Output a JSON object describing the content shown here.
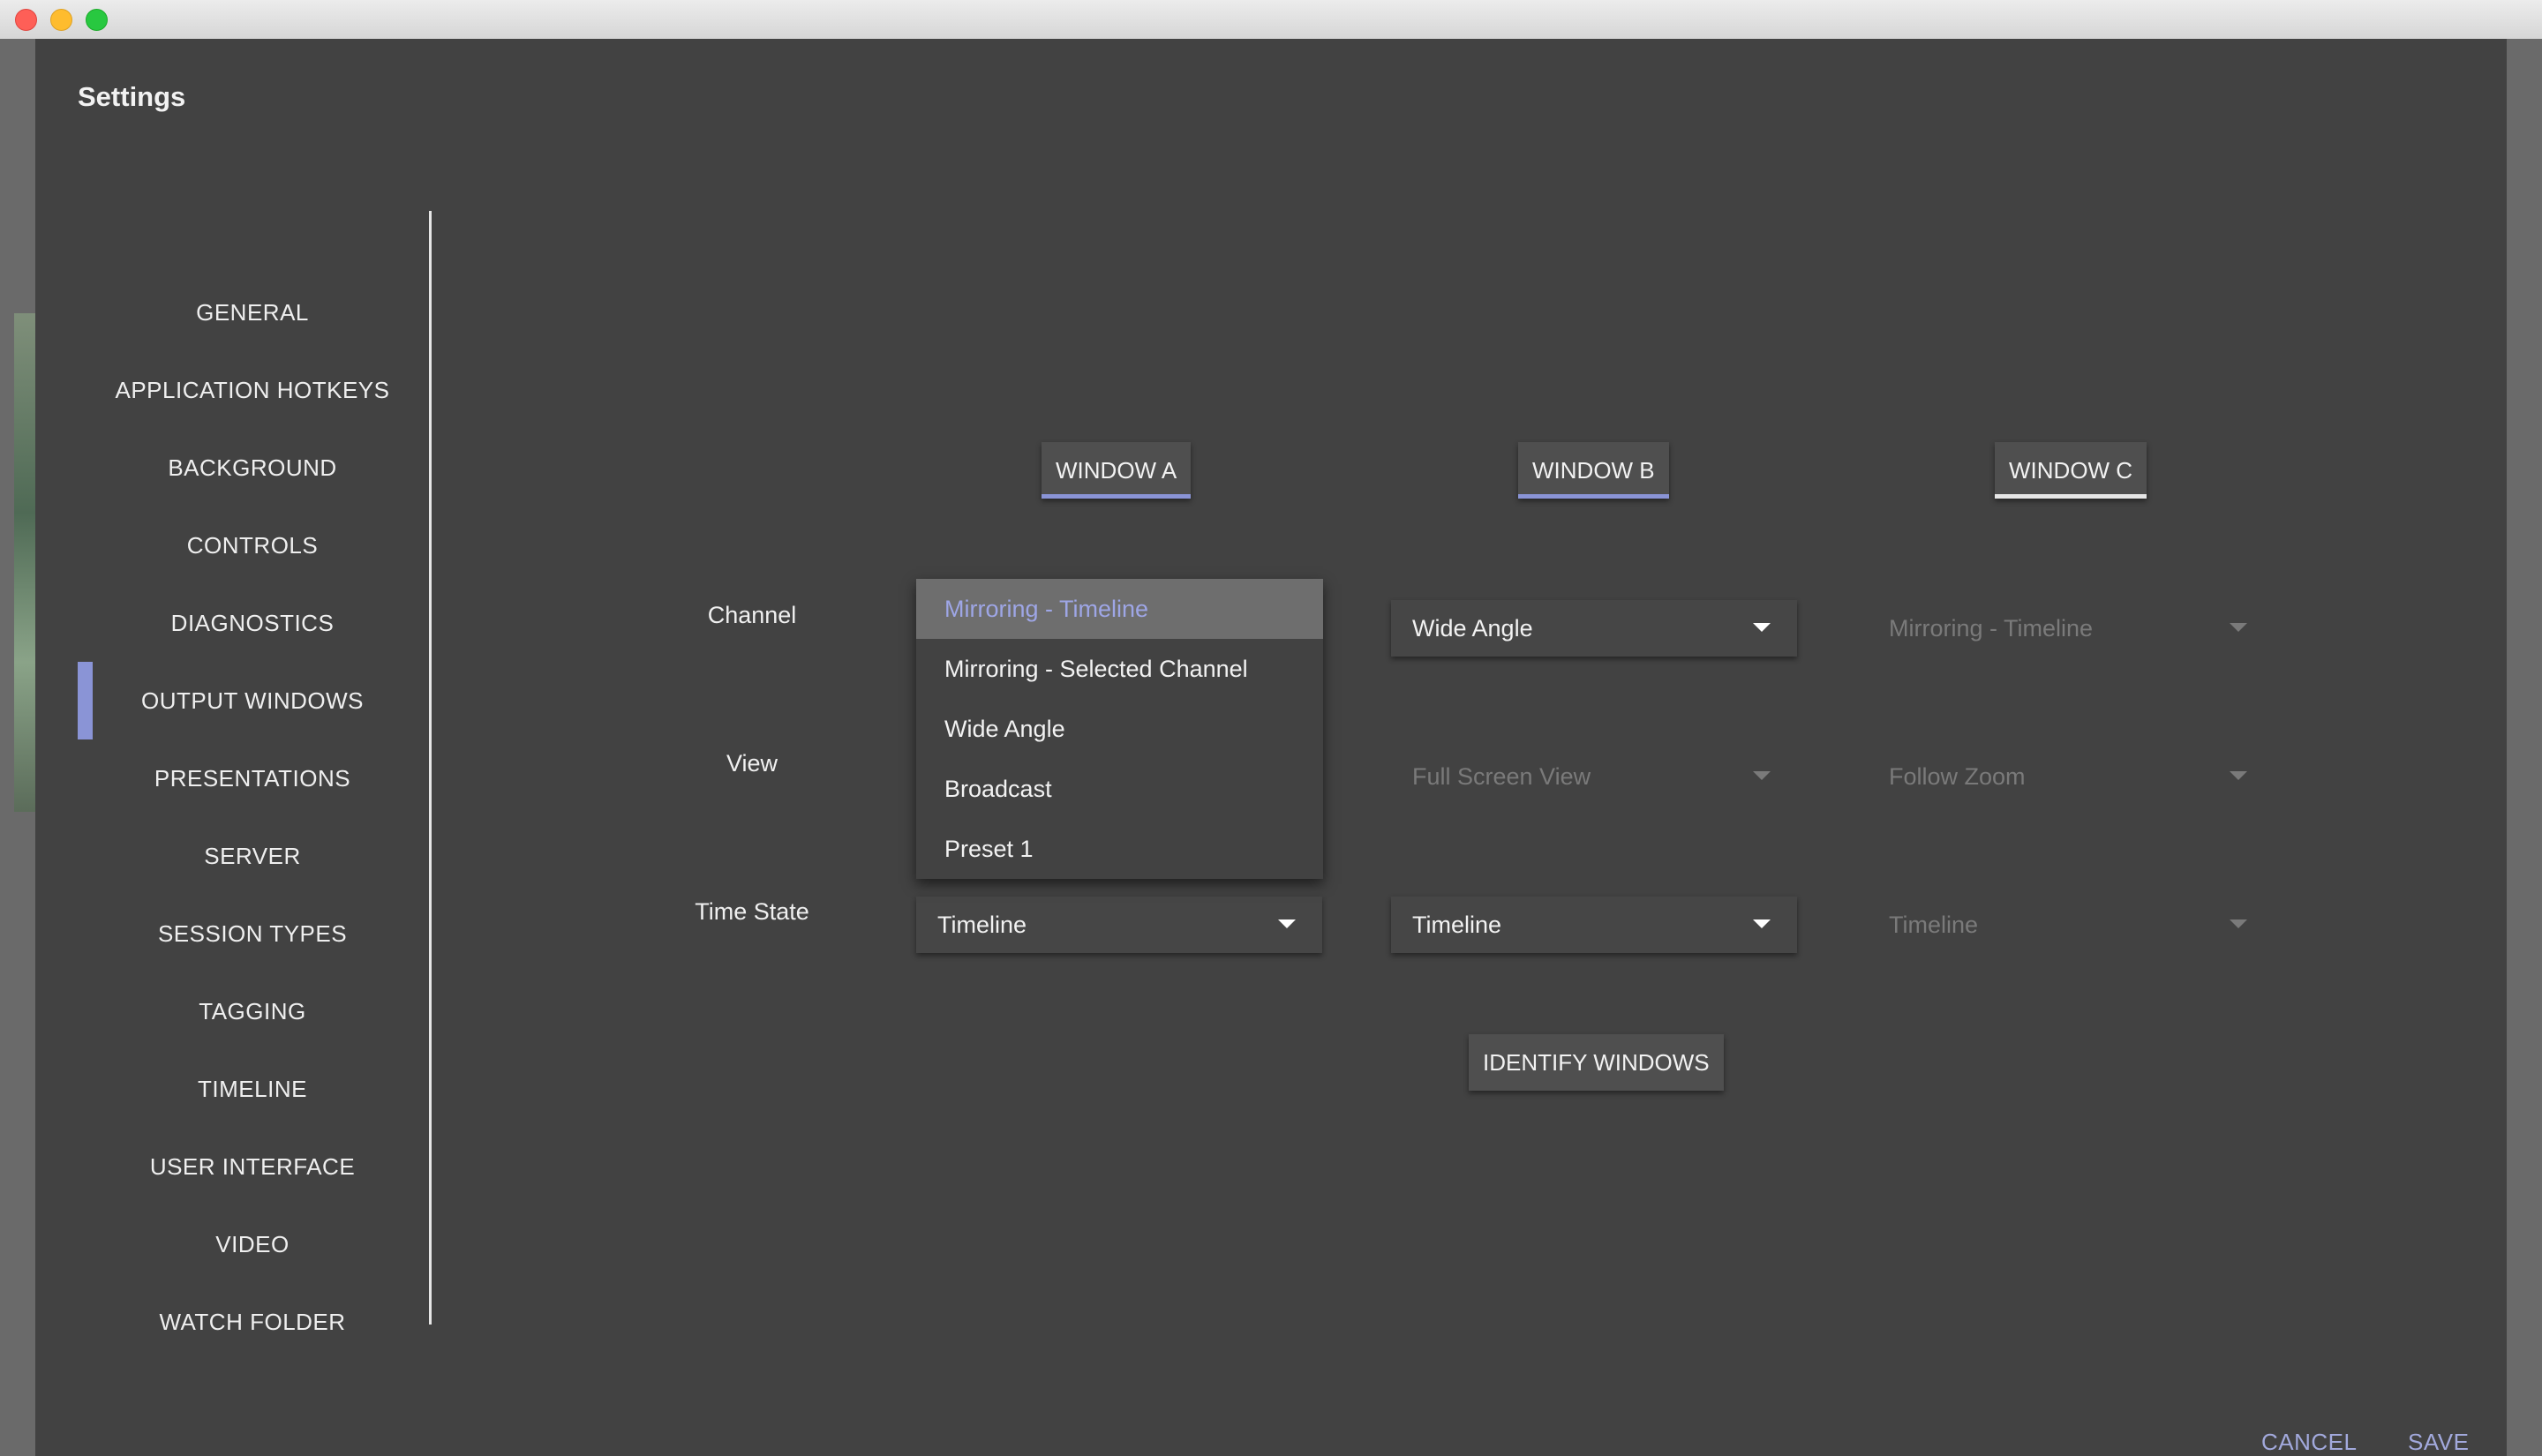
{
  "dialog": {
    "title": "Settings"
  },
  "nav": {
    "items": [
      {
        "label": "GENERAL"
      },
      {
        "label": "APPLICATION HOTKEYS"
      },
      {
        "label": "BACKGROUND"
      },
      {
        "label": "CONTROLS"
      },
      {
        "label": "DIAGNOSTICS"
      },
      {
        "label": "OUTPUT WINDOWS",
        "active": true
      },
      {
        "label": "PRESENTATIONS"
      },
      {
        "label": "SERVER"
      },
      {
        "label": "SESSION TYPES"
      },
      {
        "label": "TAGGING"
      },
      {
        "label": "TIMELINE"
      },
      {
        "label": "USER INTERFACE"
      },
      {
        "label": "VIDEO"
      },
      {
        "label": "WATCH FOLDER"
      }
    ]
  },
  "windows": {
    "tabs": [
      {
        "label": "WINDOW A"
      },
      {
        "label": "WINDOW B"
      },
      {
        "label": "WINDOW C"
      }
    ]
  },
  "rows": {
    "channel_label": "Channel",
    "view_label": "View",
    "time_state_label": "Time State"
  },
  "window_a": {
    "channel_menu": {
      "options": [
        {
          "label": "Mirroring - Timeline",
          "selected": true
        },
        {
          "label": "Mirroring - Selected Channel"
        },
        {
          "label": "Wide Angle"
        },
        {
          "label": "Broadcast"
        },
        {
          "label": "Preset 1"
        }
      ]
    },
    "time_state": "Timeline"
  },
  "window_b": {
    "channel": "Wide Angle",
    "view": "Full Screen View",
    "time_state": "Timeline"
  },
  "window_c": {
    "channel": "Mirroring - Timeline",
    "view": "Follow Zoom",
    "time_state": "Timeline"
  },
  "actions": {
    "identify_label": "IDENTIFY WINDOWS",
    "cancel_label": "CANCEL",
    "save_label": "SAVE"
  },
  "colors": {
    "accent": "#8a94d6",
    "dialog_bg": "#424242",
    "footer_text": "#a2a9dc"
  }
}
